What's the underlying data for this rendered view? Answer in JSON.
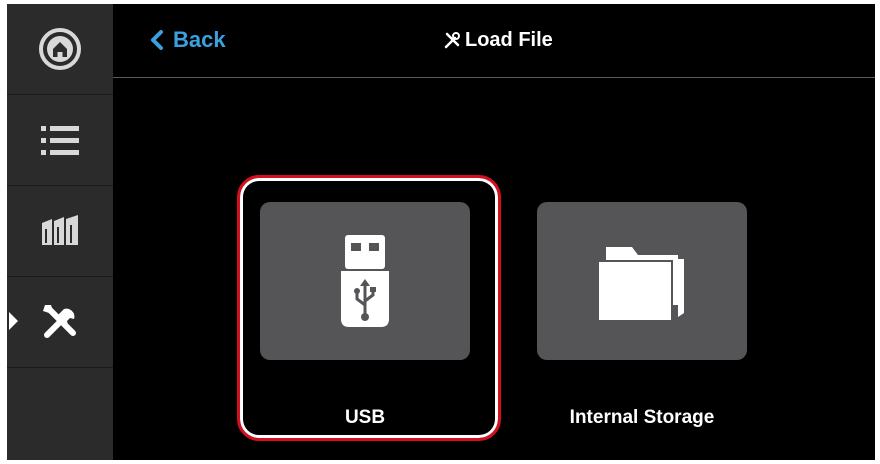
{
  "sidebar": {
    "items": [
      {
        "icon": "home-icon"
      },
      {
        "icon": "list-icon"
      },
      {
        "icon": "filament-spools-icon"
      },
      {
        "icon": "tools-icon",
        "active": true
      }
    ]
  },
  "header": {
    "back_label": "Back",
    "title": "Load File",
    "title_icon": "tools-small-icon"
  },
  "sources": [
    {
      "label": "USB",
      "icon": "usb-drive-icon",
      "highlighted": true
    },
    {
      "label": "Internal Storage",
      "icon": "folder-icon"
    }
  ],
  "colors": {
    "accent": "#3aa0e0",
    "highlight": "#d4101f",
    "tile": "#555558",
    "sidebar": "#2b2b2b"
  }
}
